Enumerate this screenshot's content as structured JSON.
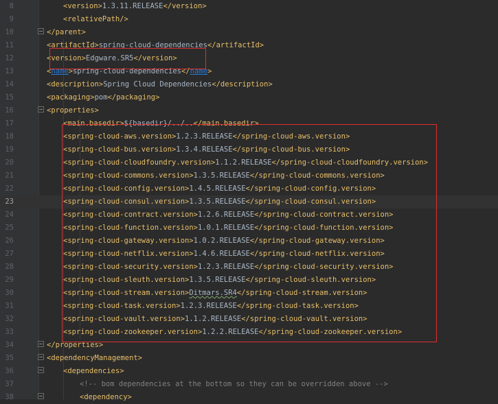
{
  "editor": {
    "lines": [
      {
        "num": "8",
        "pre": "<",
        "tag": "version",
        "mid": ">1.3.11.RELEASE</",
        "tag2": "version",
        "post": ">"
      },
      {
        "num": "9",
        "pre": "<",
        "tag": "relativePath",
        "mid": "/>",
        "tag2": "",
        "post": ""
      },
      {
        "num": "10",
        "pre": "</",
        "tag": "parent",
        "mid": ">",
        "tag2": "",
        "post": ""
      },
      {
        "num": "11",
        "pre": "<",
        "tag": "artifactId",
        "mid": ">spring-cloud-dependencies</",
        "tag2": "artifactId",
        "post": ">"
      },
      {
        "num": "12",
        "pre": "<",
        "tag": "version",
        "mid": ">Edgware.SR5</",
        "tag2": "version",
        "post": ">"
      },
      {
        "num": "13",
        "pre": "<",
        "tag": "name",
        "mid": ">spring-cloud-dependencies</",
        "tag2": "name",
        "post": ">"
      },
      {
        "num": "14",
        "pre": "<",
        "tag": "description",
        "mid": ">Spring Cloud Dependencies</",
        "tag2": "description",
        "post": ">"
      },
      {
        "num": "15",
        "pre": "<",
        "tag": "packaging",
        "mid": ">pom</",
        "tag2": "packaging",
        "post": ">"
      },
      {
        "num": "16",
        "pre": "<",
        "tag": "properties",
        "mid": ">",
        "tag2": "",
        "post": ""
      },
      {
        "num": "17",
        "pre": "<",
        "tag": "main.basedir",
        "mid": ">${basedir}/../..</",
        "tag2": "main.basedir",
        "post": ">"
      },
      {
        "num": "18",
        "pre": "<",
        "tag": "spring-cloud-aws.version",
        "mid": ">1.2.3.RELEASE</",
        "tag2": "spring-cloud-aws.version",
        "post": ">"
      },
      {
        "num": "19",
        "pre": "<",
        "tag": "spring-cloud-bus.version",
        "mid": ">1.3.4.RELEASE</",
        "tag2": "spring-cloud-bus.version",
        "post": ">"
      },
      {
        "num": "20",
        "pre": "<",
        "tag": "spring-cloud-cloudfoundry.version",
        "mid": ">1.1.2.RELEASE</",
        "tag2": "spring-cloud-cloudfoundry.version",
        "post": ">"
      },
      {
        "num": "21",
        "pre": "<",
        "tag": "spring-cloud-commons.version",
        "mid": ">1.3.5.RELEASE</",
        "tag2": "spring-cloud-commons.version",
        "post": ">"
      },
      {
        "num": "22",
        "pre": "<",
        "tag": "spring-cloud-config.version",
        "mid": ">1.4.5.RELEASE</",
        "tag2": "spring-cloud-config.version",
        "post": ">"
      },
      {
        "num": "23",
        "pre": "<",
        "tag": "spring-cloud-consul.version",
        "mid": ">1.3.5.RELEASE</",
        "tag2": "spring-cloud-consul.version",
        "post": ">"
      },
      {
        "num": "24",
        "pre": "<",
        "tag": "spring-cloud-contract.version",
        "mid": ">1.2.6.RELEASE</",
        "tag2": "spring-cloud-contract.version",
        "post": ">"
      },
      {
        "num": "25",
        "pre": "<",
        "tag": "spring-cloud-function.version",
        "mid": ">1.0.1.RELEASE</",
        "tag2": "spring-cloud-function.version",
        "post": ">"
      },
      {
        "num": "26",
        "pre": "<",
        "tag": "spring-cloud-gateway.version",
        "mid": ">1.0.2.RELEASE</",
        "tag2": "spring-cloud-gateway.version",
        "post": ">"
      },
      {
        "num": "27",
        "pre": "<",
        "tag": "spring-cloud-netflix.version",
        "mid": ">1.4.6.RELEASE</",
        "tag2": "spring-cloud-netflix.version",
        "post": ">"
      },
      {
        "num": "28",
        "pre": "<",
        "tag": "spring-cloud-security.version",
        "mid": ">1.2.3.RELEASE</",
        "tag2": "spring-cloud-security.version",
        "post": ">"
      },
      {
        "num": "29",
        "pre": "<",
        "tag": "spring-cloud-sleuth.version",
        "mid": ">1.3.5.RELEASE</",
        "tag2": "spring-cloud-sleuth.version",
        "post": ">"
      },
      {
        "num": "30",
        "pre": "<",
        "tag": "spring-cloud-stream.version",
        "mid": ">Ditmars.SR4</",
        "tag2": "spring-cloud-stream.version",
        "post": ">"
      },
      {
        "num": "31",
        "pre": "<",
        "tag": "spring-cloud-task.version",
        "mid": ">1.2.3.RELEASE</",
        "tag2": "spring-cloud-task.version",
        "post": ">"
      },
      {
        "num": "32",
        "pre": "<",
        "tag": "spring-cloud-vault.version",
        "mid": ">1.1.2.RELEASE</",
        "tag2": "spring-cloud-vault.version",
        "post": ">"
      },
      {
        "num": "33",
        "pre": "<",
        "tag": "spring-cloud-zookeeper.version",
        "mid": ">1.2.2.RELEASE</",
        "tag2": "spring-cloud-zookeeper.version",
        "post": ">"
      },
      {
        "num": "34",
        "pre": "</",
        "tag": "properties",
        "mid": ">",
        "tag2": "",
        "post": ""
      },
      {
        "num": "35",
        "pre": "<",
        "tag": "dependencyManagement",
        "mid": ">",
        "tag2": "",
        "post": ""
      },
      {
        "num": "36",
        "pre": "<",
        "tag": "dependencies",
        "mid": ">",
        "tag2": "",
        "post": ""
      },
      {
        "num": "37",
        "pre": "",
        "tag": "",
        "mid": "<!-- bom dependencies at the bottom so they can be overridden above -->",
        "tag2": "",
        "post": ""
      },
      {
        "num": "38",
        "pre": "<",
        "tag": "dependency",
        "mid": ">",
        "tag2": "",
        "post": ""
      }
    ],
    "current_line": "23",
    "colors": {
      "background": "#2b2b2b",
      "tag": "#e8bf6a",
      "text": "#a9b7c6",
      "line_number": "#606366",
      "comment": "#808080",
      "link": "#287bde",
      "highlight_box": "#e03030"
    }
  }
}
